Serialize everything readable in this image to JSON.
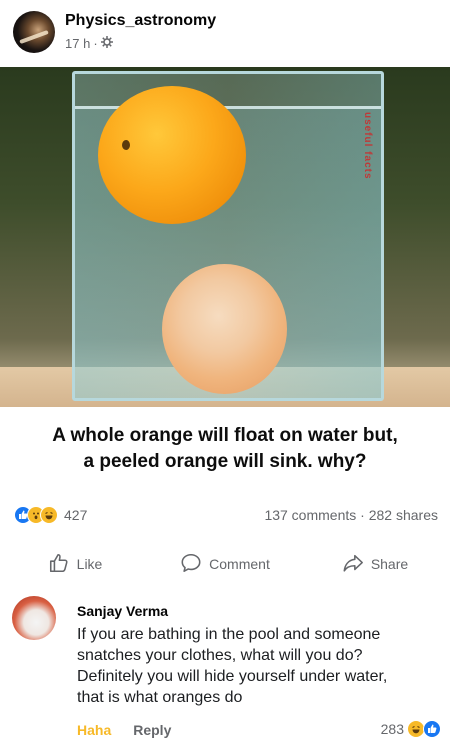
{
  "post": {
    "page_name": "Physics_astronomy",
    "time": "17 h",
    "separator": "·",
    "caption_line1": "A whole orange will float on water but,",
    "caption_line2": "a peeled orange will sink. why?",
    "watermark": "useful facts"
  },
  "stats": {
    "reaction_count": "427",
    "comments": "137 comments",
    "dot": "·",
    "shares": "282 shares"
  },
  "actions": {
    "like": "Like",
    "comment": "Comment",
    "share": "Share"
  },
  "comment": {
    "author": "Sanjay Verma",
    "line1": "If you are bathing in the pool and someone",
    "line2": "snatches your clothes, what will you do?",
    "line3": "Definitely you will hide yourself under water,",
    "line4": "that is what oranges do",
    "haha": "Haha",
    "reply": "Reply",
    "reaction_count": "283"
  },
  "colors": {
    "accent": "#1877f2",
    "haha": "#f7b928",
    "muted": "#65676b"
  }
}
